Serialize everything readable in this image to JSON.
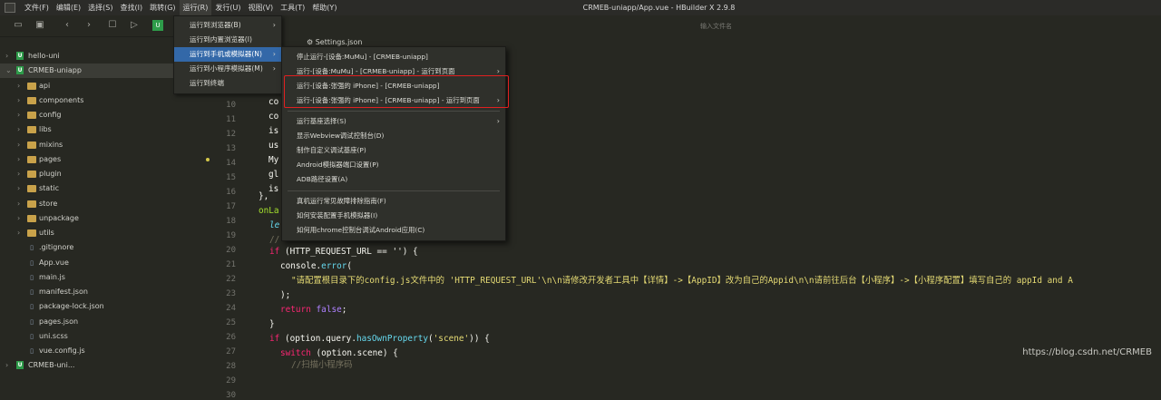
{
  "window": {
    "title": "CRMEB-uniapp/App.vue - HBuilder X 2.9.8"
  },
  "menubar": [
    "文件(F)",
    "编辑(E)",
    "选择(S)",
    "查找(I)",
    "跳转(G)",
    "运行(R)",
    "发行(U)",
    "视图(V)",
    "工具(T)",
    "帮助(Y)"
  ],
  "toolbar": {
    "search_placeholder": "输入文件名"
  },
  "tab": {
    "label": "Settings.json"
  },
  "sidebar": {
    "items": [
      {
        "label": "hello-uni",
        "kind": "project"
      },
      {
        "label": "CRMEB-uniapp",
        "kind": "project"
      },
      {
        "label": "api",
        "kind": "folder"
      },
      {
        "label": "components",
        "kind": "folder"
      },
      {
        "label": "config",
        "kind": "folder"
      },
      {
        "label": "libs",
        "kind": "folder"
      },
      {
        "label": "mixins",
        "kind": "folder"
      },
      {
        "label": "pages",
        "kind": "folder"
      },
      {
        "label": "plugin",
        "kind": "folder"
      },
      {
        "label": "static",
        "kind": "folder"
      },
      {
        "label": "store",
        "kind": "folder"
      },
      {
        "label": "unpackage",
        "kind": "folder"
      },
      {
        "label": "utils",
        "kind": "folder"
      },
      {
        "label": ".gitignore",
        "kind": "file"
      },
      {
        "label": "App.vue",
        "kind": "file"
      },
      {
        "label": "main.js",
        "kind": "file"
      },
      {
        "label": "manifest.json",
        "kind": "file"
      },
      {
        "label": "package-lock.json",
        "kind": "file"
      },
      {
        "label": "pages.json",
        "kind": "file"
      },
      {
        "label": "uni.scss",
        "kind": "file"
      },
      {
        "label": "vue.config.js",
        "kind": "file"
      },
      {
        "label": "CRMEB-uni...",
        "kind": "project"
      }
    ]
  },
  "run_menu": {
    "items": [
      "运行到浏览器(B)",
      "运行到内置浏览器(I)",
      "运行到手机或模拟器(N)",
      "运行到小程序模拟器(M)",
      "运行到终端"
    ]
  },
  "submenu": {
    "items": [
      "停止运行-[设备:MuMu] - [CRMEB-uniapp]",
      "运行-[设备:MuMu] - [CRMEB-uniapp] - 运行到页面",
      "运行-[设备:张强的 iPhone] - [CRMEB-uniapp]",
      "运行-[设备:张强的 iPhone] - [CRMEB-uniapp] - 运行到页面",
      "运行基座选择(S)",
      "显示Webview调试控制台(D)",
      "制作自定义调试基座(P)",
      "Android模拟器端口设置(P)",
      "ADB路径设置(A)",
      "真机运行常见故障排除指南(F)",
      "如何安装配置手机模拟器(I)",
      "如何用chrome控制台调试Android应用(C)"
    ]
  },
  "editor": {
    "line_numbers": [
      "9",
      "10",
      "11",
      "12",
      "13",
      "14",
      "15",
      "16",
      "17",
      "18",
      "19",
      "20",
      "21",
      "22",
      "23",
      "24",
      "25",
      "26",
      "27",
      "28",
      "29",
      "30"
    ],
    "code": {
      "l9": "co",
      "l10": "co",
      "l11": "is",
      "l12": "us",
      "l13": "My",
      "l14": "gl",
      "l15": "is",
      "l16": "ta",
      "l17": "},",
      "l18": "onLa",
      "l19": "le",
      "l20": "//",
      "l21_if": "if",
      "l21_rest": " (HTTP_REQUEST_URL == '') {",
      "l22_obj": "console",
      "l22_fn": "error",
      "l23": "\"请配置根目录下的config.js文件中的 'HTTP_REQUEST_URL'\\n\\n请修改开发者工具中【详情】->【AppID】改为自己的Appid\\n\\n请前往后台【小程序】->【小程序配置】填写自己的 appId and A",
      "l24": ");",
      "l25_kw": "return",
      "l25_val": "false",
      "l26": "}",
      "l27_if": "if",
      "l27_a": " (option.query.",
      "l27_fn": "hasOwnProperty",
      "l27_str": "'scene'",
      "l27_b": ")) {",
      "l28_kw": "switch",
      "l28_rest": " (option.scene) {",
      "l29": "//扫描小程序码"
    }
  },
  "watermark": "https://blog.csdn.net/CRMEB"
}
